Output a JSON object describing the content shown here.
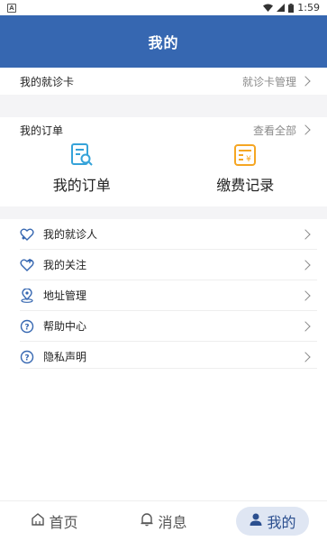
{
  "status_bar": {
    "left_badge": "A",
    "time": "1:59",
    "icons": [
      "wifi-icon",
      "signal-icon",
      "battery-icon"
    ]
  },
  "header": {
    "title": "我的"
  },
  "card": {
    "label": "我的就诊卡",
    "action": "就诊卡管理"
  },
  "orders": {
    "label": "我的订单",
    "action": "查看全部",
    "items": [
      {
        "icon": "order-list-icon",
        "label": "我的订单",
        "color": "#36a3d9"
      },
      {
        "icon": "payment-record-icon",
        "label": "缴费记录",
        "color": "#f5a623"
      }
    ]
  },
  "menu": {
    "items": [
      {
        "icon": "patient-icon",
        "label": "我的就诊人"
      },
      {
        "icon": "heart-icon",
        "label": "我的关注"
      },
      {
        "icon": "location-icon",
        "label": "地址管理"
      },
      {
        "icon": "help-icon",
        "label": "帮助中心"
      },
      {
        "icon": "privacy-icon",
        "label": "隐私声明"
      }
    ]
  },
  "tabbar": {
    "items": [
      {
        "icon": "home-icon",
        "label": "首页"
      },
      {
        "icon": "bell-icon",
        "label": "消息"
      },
      {
        "icon": "user-icon",
        "label": "我的"
      }
    ],
    "active_index": 2
  },
  "colors": {
    "brand": "#3667b1",
    "background": "#f4f4f6",
    "active_tab_bg": "#dfe6f3"
  }
}
